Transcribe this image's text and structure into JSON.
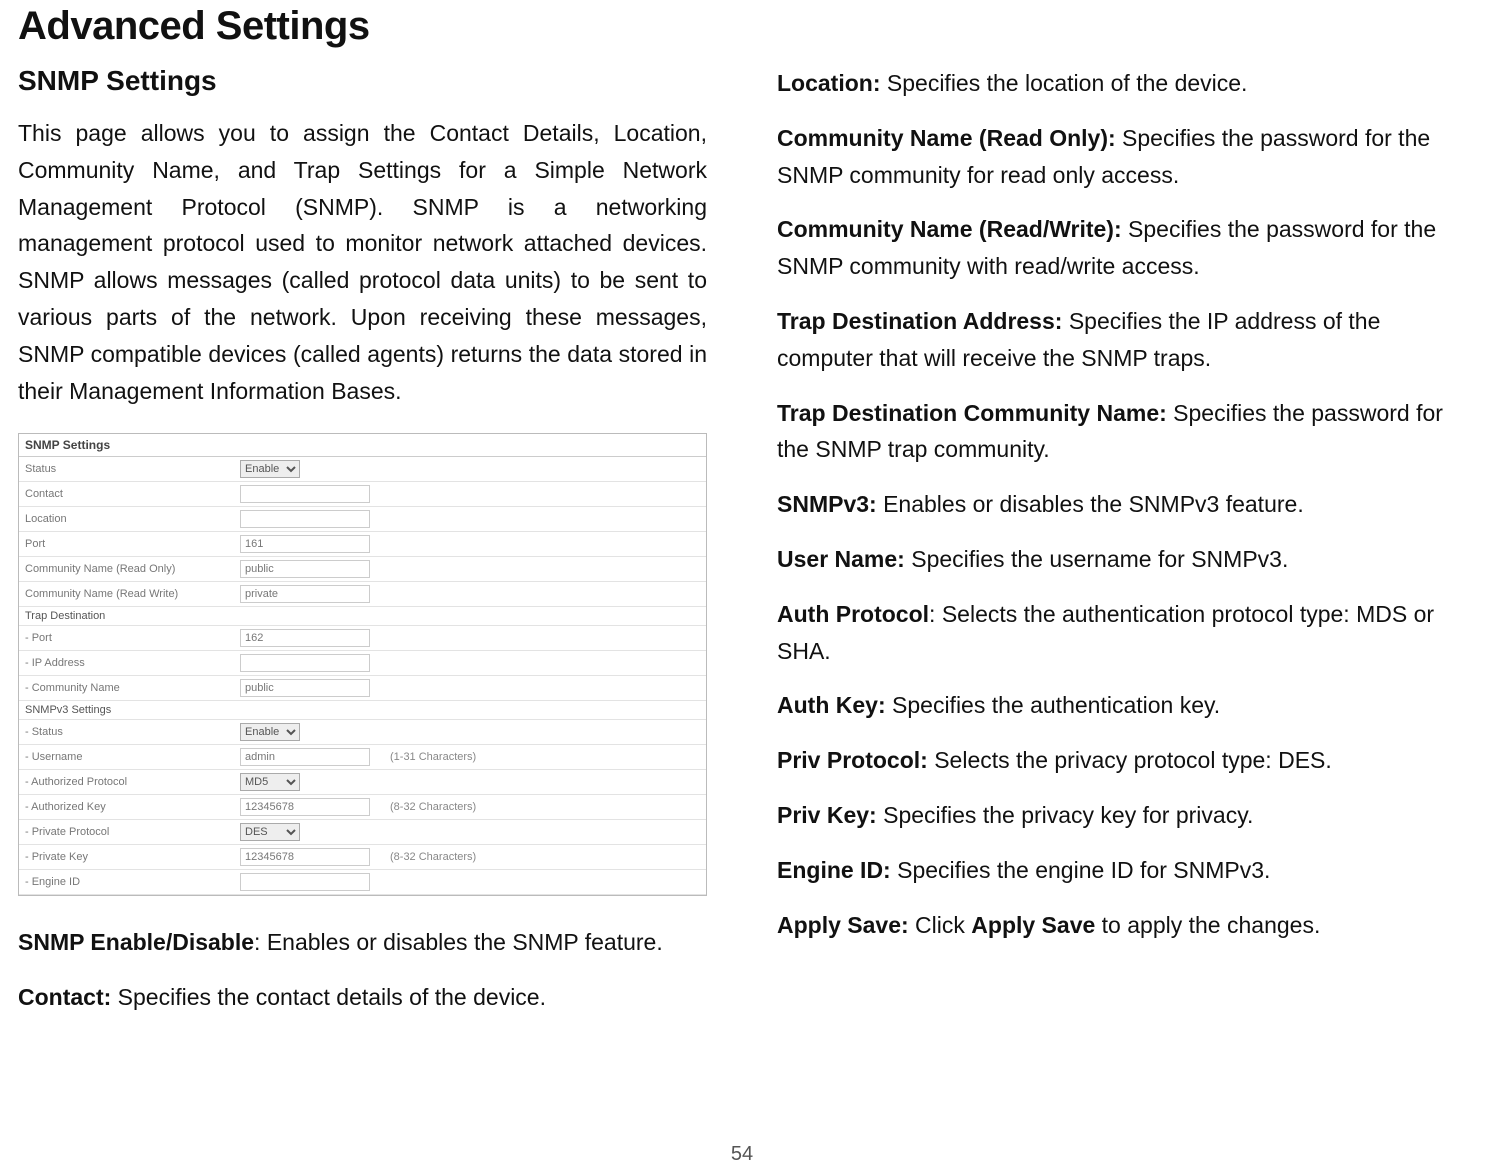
{
  "title": "Advanced Settings",
  "subtitle": "SNMP Settings",
  "intro": "This page allows you to assign the Contact Details, Location, Community Name, and Trap Settings for a Simple Network Management Protocol (SNMP). SNMP is a networking management protocol used to monitor network attached devices. SNMP allows messages (called protocol data units) to be sent to various parts of the network. Upon receiving these messages, SNMP compatible devices (called agents) returns the data stored in their Management Information Bases.",
  "screenshot": {
    "header": "SNMP Settings",
    "rows": {
      "status_label": "Status",
      "status_value": "Enable",
      "contact_label": "Contact",
      "contact_value": "",
      "location_label": "Location",
      "location_value": "",
      "port_label": "Port",
      "port_value": "161",
      "comm_ro_label": "Community Name (Read Only)",
      "comm_ro_value": "public",
      "comm_rw_label": "Community Name (Read Write)",
      "comm_rw_value": "private",
      "trap_header": "Trap Destination",
      "trap_port_label": "- Port",
      "trap_port_value": "162",
      "trap_ip_label": "- IP Address",
      "trap_ip_value": "",
      "trap_comm_label": "- Community Name",
      "trap_comm_value": "public",
      "v3_header": "SNMPv3 Settings",
      "v3_status_label": "- Status",
      "v3_status_value": "Enable",
      "v3_user_label": "- Username",
      "v3_user_value": "admin",
      "v3_user_hint": "(1-31 Characters)",
      "v3_authproto_label": "- Authorized Protocol",
      "v3_authproto_value": "MD5",
      "v3_authkey_label": "- Authorized Key",
      "v3_authkey_value": "12345678",
      "v3_authkey_hint": "(8-32 Characters)",
      "v3_privproto_label": "- Private Protocol",
      "v3_privproto_value": "DES",
      "v3_privkey_label": "- Private Key",
      "v3_privkey_value": "12345678",
      "v3_privkey_hint": "(8-32 Characters)",
      "v3_engine_label": "- Engine ID",
      "v3_engine_value": ""
    }
  },
  "left_items": [
    {
      "label": "SNMP Enable/Disable",
      "sep": ": ",
      "text": "Enables or disables the SNMP feature."
    },
    {
      "label": "Contact:",
      "sep": " ",
      "text": "Specifies the contact details of the device."
    }
  ],
  "right_items": [
    {
      "label": "Location:",
      "sep": " ",
      "text": "Specifies the location of the device."
    },
    {
      "label": "Community Name (Read Only):",
      "sep": " ",
      "text": "Specifies the password for the SNMP community for read only access."
    },
    {
      "label": "Community Name (Read/Write):",
      "sep": " ",
      "text": "Specifies the password for the SNMP community with read/write access."
    },
    {
      "label": "Trap Destination Address:",
      "sep": " ",
      "text": "Specifies the IP address of the computer that will receive the SNMP traps."
    },
    {
      "label": "Trap Destination Community Name:",
      "sep": " ",
      "text": "Specifies the password for the SNMP trap community."
    },
    {
      "label": "SNMPv3:",
      "sep": " ",
      "text": "Enables or disables the SNMPv3 feature."
    },
    {
      "label": "User Name:",
      "sep": " ",
      "text": "Specifies the username for SNMPv3."
    },
    {
      "label": "Auth Protocol",
      "sep": ": ",
      "text": "Selects the authentication protocol type: MDS or SHA."
    },
    {
      "label": "Auth Key:",
      "sep": " ",
      "text": "Specifies the authentication key."
    },
    {
      "label": "Priv Protocol:",
      "sep": " ",
      "text": "Selects the privacy protocol type: DES."
    },
    {
      "label": "Priv Key:",
      "sep": " ",
      "text": "Specifies the privacy key for privacy."
    },
    {
      "label": "Engine ID:",
      "sep": " ",
      "text": "Specifies the engine ID for SNMPv3."
    },
    {
      "label": "Apply Save:",
      "sep": " ",
      "text_prefix": "Click ",
      "bold_mid": "Apply Save",
      "text_suffix": " to apply the changes."
    }
  ],
  "page_number": "54"
}
